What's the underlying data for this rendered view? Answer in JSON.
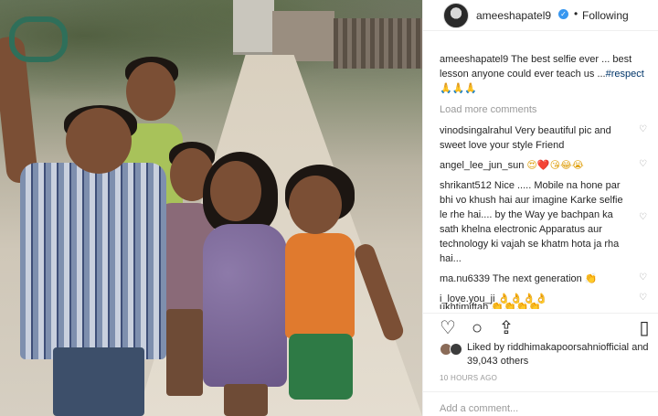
{
  "header": {
    "username": "ameeshapatel9",
    "dot": "•",
    "follow_label": "Following"
  },
  "caption": {
    "username": "ameeshapatel9",
    "text": " The best selfie ever ... best lesson anyone could ever teach us ...",
    "hashtag": "#respect",
    "emojis": " 🙏🙏🙏"
  },
  "load_more": "Load more comments",
  "comments": [
    {
      "username": "vinodsingalrahul",
      "text": " Very beautiful pic and sweet love your style Friend"
    },
    {
      "username": "angel_lee_jun_sun",
      "text": " 😍❤️😘😂😭"
    },
    {
      "username": "shrikant512",
      "text": " Nice ..... Mobile na hone par bhi vo khush hai aur imagine Karke selfie le rhe hai.... by the Way ye bachpan ka sath khelna electronic Apparatus aur technology ki vajah se khatm hota ja rha hai..."
    },
    {
      "username": "ma.nu6339",
      "text": " The next generation 👏"
    },
    {
      "username": "i_love.you_ji",
      "text": " 👌👌👌👌"
    },
    {
      "username": "ukhtimiftah",
      "text": " 👏👏👏👏"
    }
  ],
  "icons": {
    "heart": "♡",
    "verified": "✓",
    "like": "♡",
    "comment": "○",
    "share": "⇪",
    "save": "▯"
  },
  "likes": {
    "prefix": "Liked by ",
    "user": "riddhimakapoorsahniofficial",
    "suffix": " and 39,043 others"
  },
  "timestamp": "10 HOURS AGO",
  "add_comment_placeholder": "Add a comment..."
}
